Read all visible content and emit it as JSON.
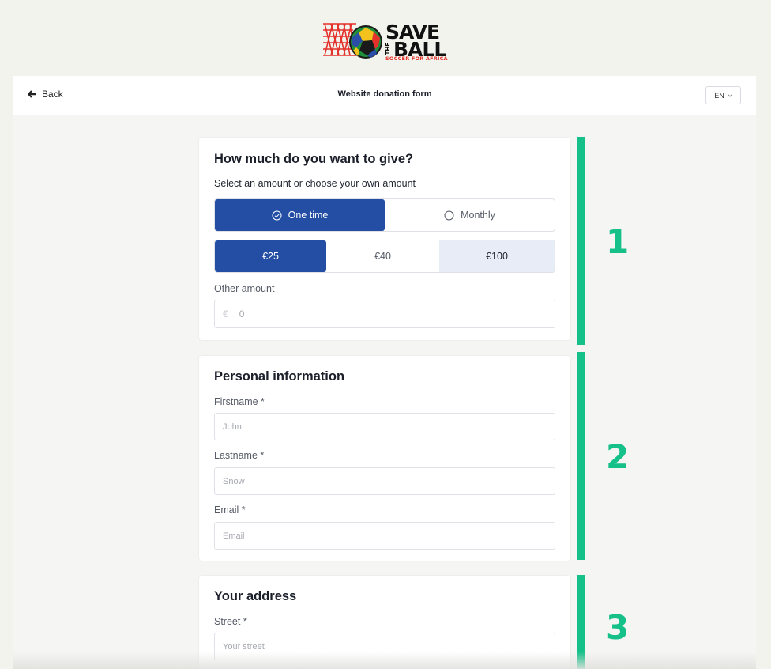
{
  "logo": {
    "save": "SAVE",
    "the": "THE",
    "ball": "BALL",
    "tagline": "SOCCER FOR AFRICA"
  },
  "header": {
    "back_label": "Back",
    "title": "Website donation form",
    "language": "EN"
  },
  "amount_section": {
    "title": "How much do you want to give?",
    "subtitle": "Select an amount or choose your own amount",
    "frequency": [
      {
        "label": "One time",
        "selected": true
      },
      {
        "label": "Monthly",
        "selected": false
      }
    ],
    "amounts": [
      {
        "label": "€25",
        "state": "selected"
      },
      {
        "label": "€40",
        "state": "default"
      },
      {
        "label": "€100",
        "state": "hover"
      }
    ],
    "other_label": "Other amount",
    "currency_symbol": "€",
    "other_placeholder": "0"
  },
  "personal_section": {
    "title": "Personal information",
    "firstname_label": "Firstname *",
    "firstname_placeholder": "John",
    "lastname_label": "Lastname *",
    "lastname_placeholder": "Snow",
    "email_label": "Email *",
    "email_placeholder": "Email"
  },
  "address_section": {
    "title": "Your address",
    "street_label": "Street *",
    "street_placeholder": "Your street"
  },
  "step_numbers": [
    "1",
    "2",
    "3"
  ],
  "colors": {
    "accent": "#234ea4",
    "step_green": "#15c089",
    "background": "#f2f3ec",
    "logo_red": "#e4312b"
  }
}
